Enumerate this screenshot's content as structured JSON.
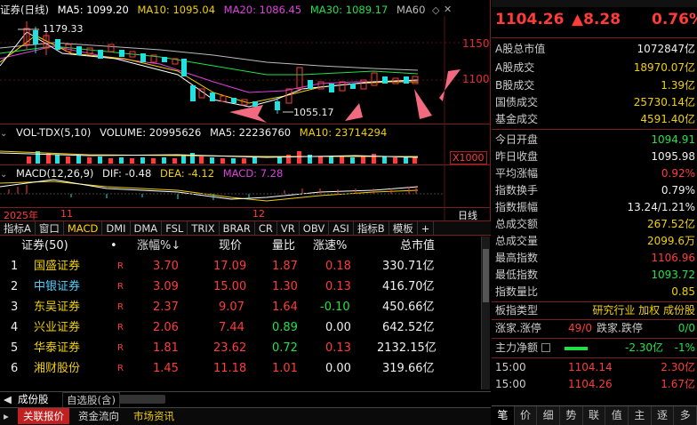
{
  "chart": {
    "title": "证券(日线)",
    "ma": [
      {
        "label": "MA5: 1099.20",
        "color": "#ffffff"
      },
      {
        "label": "MA10: 1095.04",
        "color": "#f0d000"
      },
      {
        "label": "MA20: 1086.45",
        "color": "#e040e0"
      },
      {
        "label": "MA30: 1089.17",
        "color": "#22e04a"
      },
      {
        "label": "MA60",
        "color": "#bbbbbb"
      }
    ],
    "price_ticks": [
      "1150",
      "1100"
    ],
    "high_label": "1179.33",
    "low_label": "1055.17",
    "vol": {
      "name": "VOL-TDX(5,10)",
      "volume": "VOLUME: 20995626",
      "ma5": "MA5: 22236760",
      "ma10": "MA10: 23714294",
      "unit": "X1000"
    },
    "macd": {
      "name": "MACD(12,26,9)",
      "dif": "DIF: -0.48",
      "dea": "DEA: -4.12",
      "macd": "MACD: 7.28"
    },
    "dates": [
      "2025年",
      "11",
      "12"
    ],
    "period": "日线"
  },
  "indicator_tabs": [
    "指标A",
    "窗口",
    "MACD",
    "DMI",
    "DMA",
    "FSL",
    "TRIX",
    "BRAR",
    "CR",
    "VR",
    "OBV",
    "ASI",
    "指标B",
    "模板",
    "+"
  ],
  "list": {
    "headers": {
      "name": "证券(50)",
      "dot": "•",
      "pct": "涨幅%↓",
      "price": "现价",
      "vr": "量比",
      "speed": "涨速%",
      "cap": "总市值"
    },
    "rows": [
      {
        "idx": "1",
        "name": "国盛证券",
        "r": "R",
        "pct": "3.70",
        "price": "17.09",
        "vr": "1.87",
        "speed": "0.18",
        "cap": "330.71亿"
      },
      {
        "idx": "2",
        "name": "中银证券",
        "r": "R",
        "pct": "3.09",
        "price": "15.00",
        "vr": "1.30",
        "speed": "0.13",
        "cap": "416.70亿"
      },
      {
        "idx": "3",
        "name": "东吴证券",
        "r": "R",
        "pct": "2.37",
        "price": "9.07",
        "vr": "1.64",
        "speed": "-0.10",
        "cap": "450.66亿"
      },
      {
        "idx": "4",
        "name": "兴业证券",
        "r": "R",
        "pct": "2.06",
        "price": "7.44",
        "vr": "0.89",
        "speed": "0.00",
        "cap": "642.52亿"
      },
      {
        "idx": "5",
        "name": "华泰证券",
        "r": "R",
        "pct": "1.81",
        "price": "23.62",
        "vr": "0.72",
        "speed": "0.13",
        "cap": "2132.15亿"
      },
      {
        "idx": "6",
        "name": "湘财股份",
        "r": "R",
        "pct": "1.45",
        "price": "11.18",
        "vr": "1.01",
        "speed": "0.00",
        "cap": "319.66亿"
      }
    ]
  },
  "bottom_tabs1": [
    "成份股",
    "自选股(含)"
  ],
  "bottom_tabs2": [
    "关联报价",
    "资金流向",
    "市场资讯"
  ],
  "quote": {
    "price": "1104.26",
    "change": "▲8.28",
    "pct": "0.76%"
  },
  "stats": [
    {
      "k": "A股总市值",
      "v": "1072847亿",
      "c": "white"
    },
    {
      "k": "A股成交",
      "v": "18970.07亿",
      "c": "yellow"
    },
    {
      "k": "B股成交",
      "v": "1.39亿",
      "c": "yellow"
    },
    {
      "k": "国债成交",
      "v": "25730.14亿",
      "c": "yellow"
    },
    {
      "k": "基金成交",
      "v": "4591.40亿",
      "c": "yellow"
    },
    {
      "k": "今日开盘",
      "v": "1094.91",
      "c": "green"
    },
    {
      "k": "昨日收盘",
      "v": "1095.98",
      "c": "white"
    },
    {
      "k": "平均涨幅",
      "v": "0.92%",
      "c": "red"
    },
    {
      "k": "指数换手",
      "v": "0.79%",
      "c": "white"
    },
    {
      "k": "指数振幅",
      "v": "13.24/1.21%",
      "c": "white"
    },
    {
      "k": "总成交额",
      "v": "267.52亿",
      "c": "yellow"
    },
    {
      "k": "总成交量",
      "v": "2099.6万",
      "c": "yellow"
    },
    {
      "k": "最高指数",
      "v": "1106.96",
      "c": "red"
    },
    {
      "k": "最低指数",
      "v": "1093.72",
      "c": "green"
    },
    {
      "k": "指数量比",
      "v": "0.85",
      "c": "yellow"
    }
  ],
  "sector": {
    "k": "板指类型",
    "v": "研究行业 加权 成份股"
  },
  "breadth": {
    "k": "涨家.涨停",
    "v1": "49/0",
    "k2": "跌家.跌停",
    "v2": "0/0"
  },
  "flow": {
    "k": "主力净额",
    "v1": "-2.30亿",
    "v2": "-1%"
  },
  "ticks": [
    {
      "time": "15:00",
      "price": "1104.14",
      "amt": "2.30亿"
    },
    {
      "time": "15:00",
      "price": "1104.26",
      "amt": "1.67亿"
    }
  ],
  "right_tabs": [
    "笔",
    "价",
    "细",
    "势",
    "联",
    "值",
    "主",
    "逐",
    "多"
  ]
}
